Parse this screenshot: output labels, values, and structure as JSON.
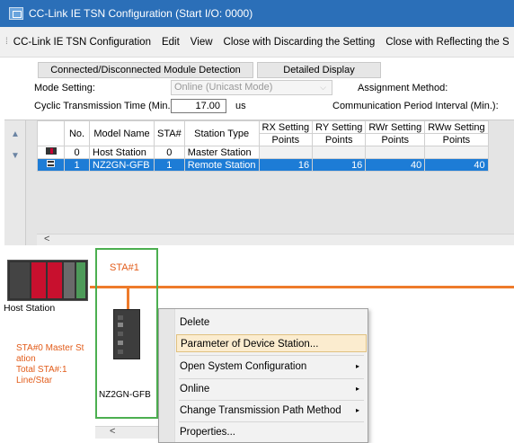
{
  "window": {
    "title": "CC-Link IE TSN Configuration (Start I/O: 0000)"
  },
  "menu": [
    "CC-Link IE TSN Configuration",
    "Edit",
    "View",
    "Close with Discarding the Setting",
    "Close with Reflecting the S"
  ],
  "toolbar": {
    "detect_label": "Connected/Disconnected Module Detection",
    "detail_label": "Detailed Display"
  },
  "settings": {
    "mode_label": "Mode Setting:",
    "mode_value": "Online (Unicast Mode)",
    "assign_label": "Assignment Method:",
    "cyclic_label": "Cyclic Transmission Time (Min.):",
    "cyclic_value": "17.00",
    "cyclic_unit": "us",
    "comm_label": "Communication Period Interval (Min.):"
  },
  "grid": {
    "headers": [
      "No.",
      "Model Name",
      "STA#",
      "Station Type",
      "RX Setting",
      "RY Setting",
      "RWr Setting",
      "RWw Setting"
    ],
    "subheader": "Points",
    "rows": [
      {
        "no": "0",
        "model": "Host Station",
        "sta": "0",
        "type": "Master Station",
        "rx": "",
        "ry": "",
        "rwr": "",
        "rww": ""
      },
      {
        "no": "1",
        "model": "NZ2GN-GFB",
        "sta": "1",
        "type": "Remote Station",
        "rx": "16",
        "ry": "16",
        "rwr": "40",
        "rww": "40"
      }
    ],
    "scroll_left": "<"
  },
  "diagram": {
    "host_label": "Host Station",
    "sta_label": "STA#1",
    "info_line1": "STA#0  Master St",
    "info_line2": "ation",
    "info_line3": "Total STA#:1",
    "info_line4": "Line/Star",
    "device_label": "NZ2GN-GFB",
    "scroll_left": "<"
  },
  "context_menu": {
    "items": [
      "Delete",
      "Parameter of Device Station...",
      "Open System Configuration",
      "Online",
      "Change Transmission Path Method",
      "Properties..."
    ],
    "submenu_arrow": "▸"
  },
  "colors": {
    "title_bg": "#2b6fb8",
    "selection": "#1d7cd6",
    "network_line": "#ee7b2b",
    "station_frame": "#4caf50",
    "info_text": "#e25c1a"
  }
}
